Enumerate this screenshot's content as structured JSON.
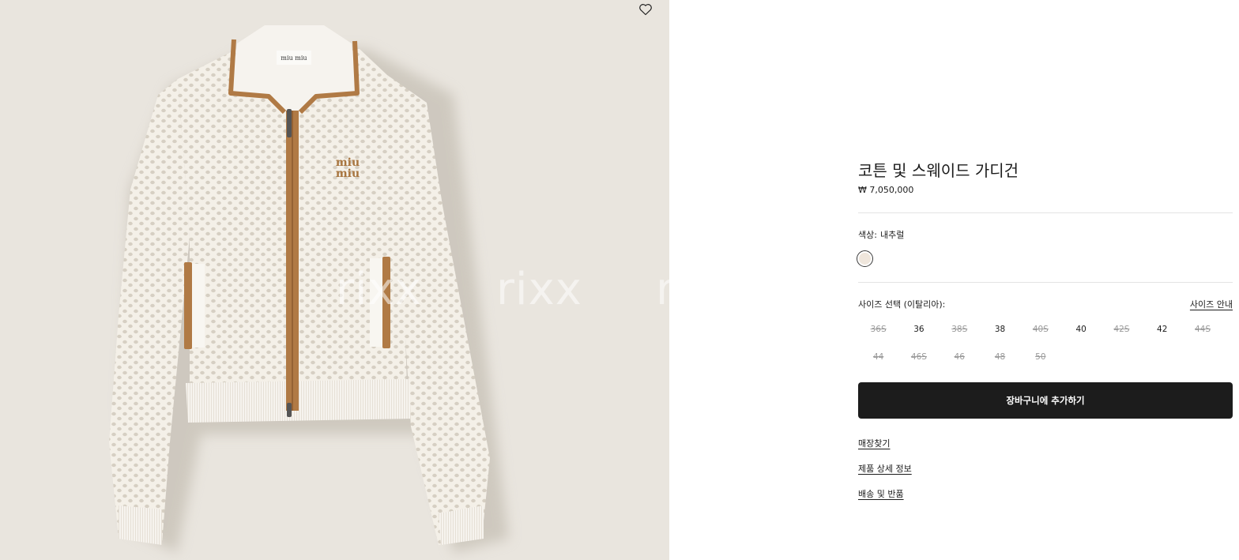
{
  "product": {
    "title": "코튼 및 스웨이드 가디건",
    "price": "₩ 7,050,000"
  },
  "image": {
    "description": "cream open-knit zip cardigan with tan suede trim",
    "watermark": [
      "rixx",
      "rixx",
      "r"
    ],
    "wishlist_icon": "heart-outline-icon",
    "label_text": "miu miu",
    "embroidery_text": "miu miu",
    "colors": {
      "background": "#e9e5de",
      "knit": "#f4f0e8",
      "trim": "#b07a45"
    }
  },
  "color": {
    "label": "색상:",
    "value": "내추럴",
    "swatch": "#efe6dc"
  },
  "size": {
    "label": "사이즈 선택 (이탈리아):",
    "guide_label": "사이즈 안내",
    "options": [
      {
        "label": "36S",
        "available": false
      },
      {
        "label": "36",
        "available": true
      },
      {
        "label": "38S",
        "available": false
      },
      {
        "label": "38",
        "available": true
      },
      {
        "label": "40S",
        "available": false
      },
      {
        "label": "40",
        "available": true
      },
      {
        "label": "42S",
        "available": false
      },
      {
        "label": "42",
        "available": true
      },
      {
        "label": "44S",
        "available": false
      },
      {
        "label": "44",
        "available": false
      },
      {
        "label": "46S",
        "available": false
      },
      {
        "label": "46",
        "available": false
      },
      {
        "label": "48",
        "available": false
      },
      {
        "label": "50",
        "available": false
      }
    ]
  },
  "cart": {
    "button_label": "장바구니에 추가하기",
    "button_color": "#1c1c1c"
  },
  "links": {
    "store_finder": "매장찾기",
    "details": "제품 상세 정보",
    "shipping": "배송 및 반품"
  }
}
